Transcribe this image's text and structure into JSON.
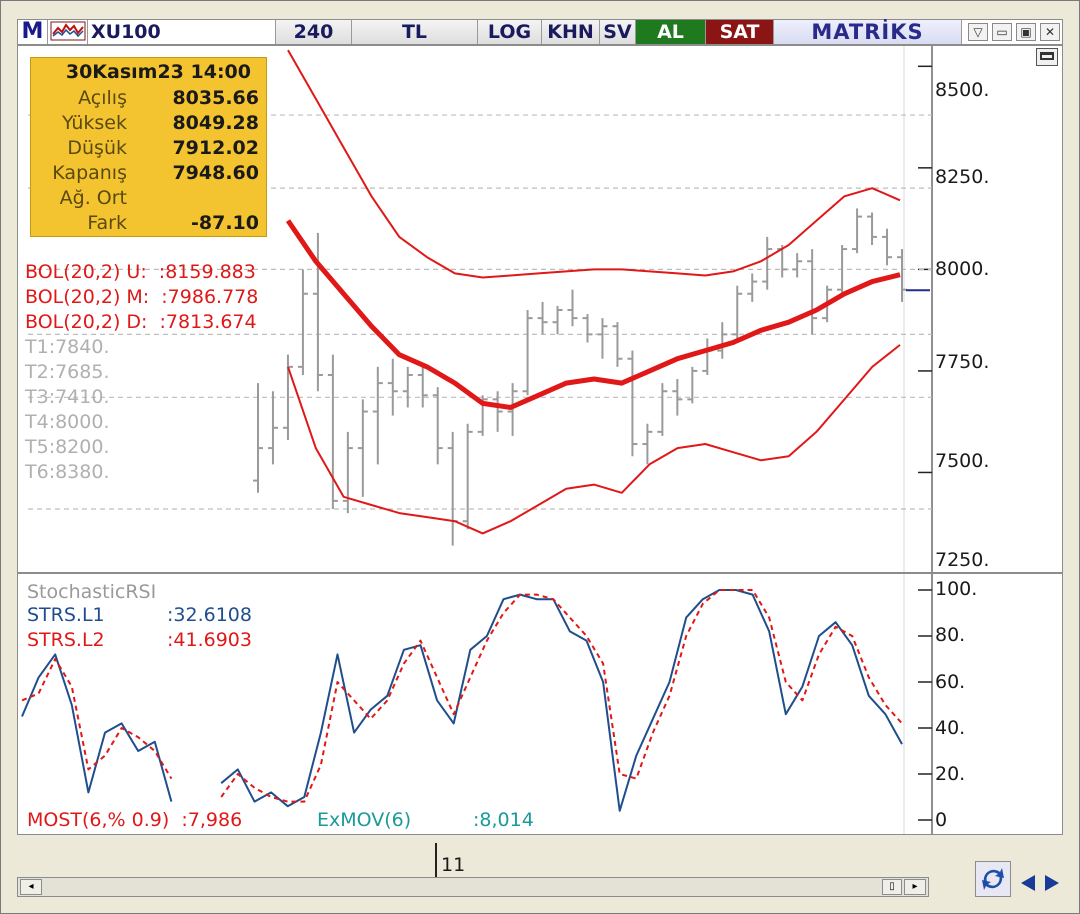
{
  "toolbar": {
    "m": "M",
    "symbol": "XU100",
    "period": "240",
    "currency": "TL",
    "log": "LOG",
    "khn": "KHN",
    "sv": "SV",
    "buy": "AL",
    "sell": "SAT",
    "brand": "MATRİKS"
  },
  "tooltip": {
    "date": "30Kasım23 14:00",
    "rows": [
      {
        "k": "Açılış",
        "v": "8035.66"
      },
      {
        "k": "Yüksek",
        "v": "8049.28"
      },
      {
        "k": "Düşük",
        "v": "7912.02"
      },
      {
        "k": "Kapanış",
        "v": "7948.60"
      },
      {
        "k": "Ağ. Ort",
        "v": ""
      },
      {
        "k": "Fark",
        "v": "-87.10"
      }
    ]
  },
  "price_labels": {
    "bol_u": "BOL(20,2) U:  :8159.883",
    "bol_m": "BOL(20,2) M:  :7986.778",
    "bol_d": "BOL(20,2) D:  :7813.674",
    "t1": "T1:7840.",
    "t2": "T2:7685.",
    "t3": "T3:7410.",
    "t4": "T4:8000.",
    "t5": "T5:8200.",
    "t6": "T6:8380."
  },
  "price_axis": [
    "8500.",
    "8250.",
    "8000.",
    "7750.",
    "7500.",
    "7250."
  ],
  "osc": {
    "title": "StochasticRSI",
    "l1": "STRS.L1",
    "l1v": ":32.6108",
    "l2": "STRS.L2",
    "l2v": ":41.6903",
    "most": "MOST(6,% 0.9)  :7,986",
    "exmov": "ExMOV(6)",
    "exmovv": ":8,014"
  },
  "osc_axis": [
    "100.",
    "80.",
    "60.",
    "40.",
    "20.",
    "0"
  ],
  "time_label": "11",
  "colors": {
    "bollinger": "#e01818",
    "stoch_l1": "#1f4e8c",
    "stoch_l2": "#e01818",
    "tooltip_bg": "#f4c430"
  },
  "chart_data": {
    "type": "ohlc",
    "price_range": [
      7250,
      8550
    ],
    "osc_range": [
      0,
      100
    ],
    "bars": [
      {
        "o": 7480,
        "h": 7720,
        "l": 7450,
        "c": 7560
      },
      {
        "o": 7560,
        "h": 7700,
        "l": 7520,
        "c": 7610
      },
      {
        "o": 7610,
        "h": 7790,
        "l": 7580,
        "c": 7760
      },
      {
        "o": 7760,
        "h": 8000,
        "l": 7740,
        "c": 7940
      },
      {
        "o": 7940,
        "h": 8090,
        "l": 7700,
        "c": 7740
      },
      {
        "o": 7740,
        "h": 7790,
        "l": 7410,
        "c": 7430
      },
      {
        "o": 7430,
        "h": 7600,
        "l": 7400,
        "c": 7560
      },
      {
        "o": 7560,
        "h": 7680,
        "l": 7440,
        "c": 7650
      },
      {
        "o": 7650,
        "h": 7760,
        "l": 7520,
        "c": 7720
      },
      {
        "o": 7720,
        "h": 7780,
        "l": 7640,
        "c": 7700
      },
      {
        "o": 7700,
        "h": 7760,
        "l": 7660,
        "c": 7740
      },
      {
        "o": 7740,
        "h": 7760,
        "l": 7660,
        "c": 7690
      },
      {
        "o": 7690,
        "h": 7710,
        "l": 7520,
        "c": 7560
      },
      {
        "o": 7560,
        "h": 7600,
        "l": 7320,
        "c": 7380
      },
      {
        "o": 7380,
        "h": 7620,
        "l": 7360,
        "c": 7600
      },
      {
        "o": 7600,
        "h": 7690,
        "l": 7590,
        "c": 7680
      },
      {
        "o": 7680,
        "h": 7700,
        "l": 7600,
        "c": 7650
      },
      {
        "o": 7650,
        "h": 7720,
        "l": 7590,
        "c": 7700
      },
      {
        "o": 7700,
        "h": 7900,
        "l": 7690,
        "c": 7880
      },
      {
        "o": 7880,
        "h": 7920,
        "l": 7840,
        "c": 7870
      },
      {
        "o": 7870,
        "h": 7910,
        "l": 7840,
        "c": 7900
      },
      {
        "o": 7900,
        "h": 7950,
        "l": 7860,
        "c": 7880
      },
      {
        "o": 7880,
        "h": 7890,
        "l": 7820,
        "c": 7840
      },
      {
        "o": 7840,
        "h": 7880,
        "l": 7780,
        "c": 7860
      },
      {
        "o": 7860,
        "h": 7870,
        "l": 7760,
        "c": 7780
      },
      {
        "o": 7780,
        "h": 7800,
        "l": 7540,
        "c": 7570
      },
      {
        "o": 7570,
        "h": 7620,
        "l": 7520,
        "c": 7600
      },
      {
        "o": 7600,
        "h": 7720,
        "l": 7590,
        "c": 7700
      },
      {
        "o": 7700,
        "h": 7730,
        "l": 7640,
        "c": 7680
      },
      {
        "o": 7680,
        "h": 7760,
        "l": 7670,
        "c": 7750
      },
      {
        "o": 7750,
        "h": 7830,
        "l": 7740,
        "c": 7800
      },
      {
        "o": 7800,
        "h": 7870,
        "l": 7780,
        "c": 7840
      },
      {
        "o": 7840,
        "h": 7960,
        "l": 7830,
        "c": 7940
      },
      {
        "o": 7940,
        "h": 7990,
        "l": 7920,
        "c": 7970
      },
      {
        "o": 7970,
        "h": 8080,
        "l": 7950,
        "c": 8050
      },
      {
        "o": 8050,
        "h": 8060,
        "l": 7980,
        "c": 8000
      },
      {
        "o": 8000,
        "h": 8040,
        "l": 7980,
        "c": 8020
      },
      {
        "o": 8020,
        "h": 8050,
        "l": 7840,
        "c": 7880
      },
      {
        "o": 7880,
        "h": 7960,
        "l": 7870,
        "c": 7950
      },
      {
        "o": 7950,
        "h": 8060,
        "l": 7940,
        "c": 8050
      },
      {
        "o": 8050,
        "h": 8150,
        "l": 8040,
        "c": 8130
      },
      {
        "o": 8130,
        "h": 8140,
        "l": 8060,
        "c": 8080
      },
      {
        "o": 8080,
        "h": 8100,
        "l": 8010,
        "c": 8030
      },
      {
        "o": 8030,
        "h": 8050,
        "l": 7920,
        "c": 7950
      }
    ],
    "bol_upper": [
      8540,
      8420,
      8300,
      8180,
      8080,
      8030,
      7990,
      7980,
      7985,
      7990,
      7995,
      8000,
      8000,
      7995,
      7990,
      7985,
      7995,
      8020,
      8060,
      8120,
      8180,
      8200,
      8170
    ],
    "bol_mid": [
      8120,
      8020,
      7940,
      7860,
      7790,
      7760,
      7720,
      7670,
      7660,
      7690,
      7720,
      7730,
      7720,
      7750,
      7780,
      7800,
      7820,
      7850,
      7870,
      7900,
      7940,
      7970,
      7987
    ],
    "bol_lower": [
      7760,
      7560,
      7440,
      7420,
      7400,
      7390,
      7380,
      7350,
      7380,
      7420,
      7460,
      7470,
      7450,
      7520,
      7560,
      7570,
      7550,
      7530,
      7540,
      7600,
      7680,
      7760,
      7814
    ],
    "stoch_l1": [
      45,
      62,
      72,
      50,
      12,
      38,
      42,
      30,
      34,
      8,
      null,
      null,
      16,
      22,
      8,
      12,
      6,
      10,
      38,
      72,
      38,
      48,
      54,
      74,
      76,
      52,
      42,
      74,
      80,
      96,
      98,
      96,
      96,
      82,
      78,
      60,
      4,
      28,
      44,
      60,
      88,
      96,
      100,
      100,
      98,
      82,
      46,
      58,
      80,
      86,
      76,
      54,
      46,
      33
    ],
    "stoch_l2": [
      52,
      55,
      70,
      58,
      22,
      28,
      40,
      36,
      30,
      18,
      null,
      null,
      10,
      20,
      14,
      10,
      8,
      8,
      24,
      60,
      52,
      44,
      52,
      68,
      78,
      62,
      46,
      62,
      78,
      90,
      98,
      98,
      96,
      88,
      80,
      68,
      20,
      18,
      38,
      54,
      80,
      94,
      100,
      100,
      100,
      88,
      60,
      52,
      72,
      84,
      80,
      62,
      50,
      42
    ]
  }
}
